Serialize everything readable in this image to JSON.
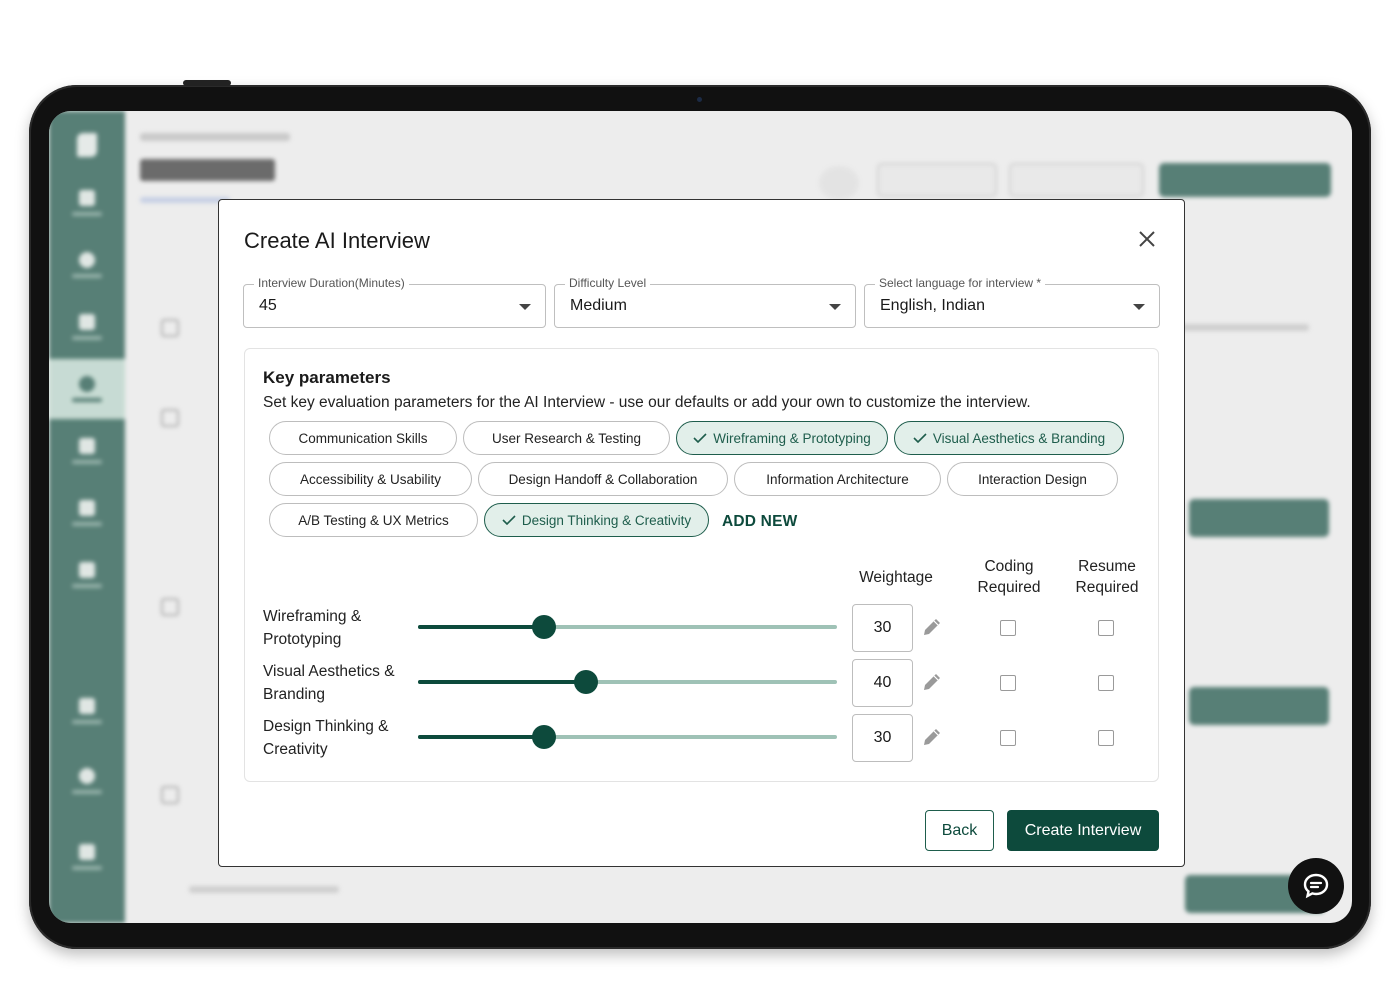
{
  "modal": {
    "title": "Create AI Interview",
    "fields": {
      "duration": {
        "label": "Interview Duration(Minutes)",
        "value": "45"
      },
      "difficulty": {
        "label": "Difficulty Level",
        "value": "Medium"
      },
      "language": {
        "label": "Select language for interview *",
        "value": "English, Indian"
      }
    },
    "params": {
      "title": "Key parameters",
      "description": "Set key evaluation parameters for the AI Interview - use our defaults or add your own to customize the interview.",
      "chips": [
        {
          "label": "Communication Skills",
          "selected": false
        },
        {
          "label": "User Research & Testing",
          "selected": false
        },
        {
          "label": "Wireframing & Prototyping",
          "selected": true
        },
        {
          "label": "Visual Aesthetics & Branding",
          "selected": true
        },
        {
          "label": "Accessibility & Usability",
          "selected": false
        },
        {
          "label": "Design Handoff & Collaboration",
          "selected": false
        },
        {
          "label": "Information Architecture",
          "selected": false
        },
        {
          "label": "Interaction Design",
          "selected": false
        },
        {
          "label": "A/B Testing & UX Metrics",
          "selected": false
        },
        {
          "label": "Design Thinking & Creativity",
          "selected": true
        }
      ],
      "add_new": "ADD NEW",
      "columns": {
        "weightage": "Weightage",
        "coding_l1": "Coding",
        "coding_l2": "Required",
        "resume_l1": "Resume",
        "resume_l2": "Required"
      },
      "rows": [
        {
          "label_l1": "Wireframing &",
          "label_l2": "Prototyping",
          "slider_fraction": 0.3,
          "weightage": "30",
          "coding_required": false,
          "resume_required": false
        },
        {
          "label_l1": "Visual Aesthetics &",
          "label_l2": "Branding",
          "slider_fraction": 0.4,
          "weightage": "40",
          "coding_required": false,
          "resume_required": false
        },
        {
          "label_l1": "Design Thinking &",
          "label_l2": "Creativity",
          "slider_fraction": 0.3,
          "weightage": "30",
          "coding_required": false,
          "resume_required": false
        }
      ]
    },
    "buttons": {
      "back": "Back",
      "create": "Create Interview"
    }
  },
  "icons": {
    "close": "close-icon",
    "caret": "chevron-down-icon",
    "check": "check-icon",
    "edit": "pencil-icon",
    "chat": "chat-icon"
  },
  "colors": {
    "brand": "#0d4a3c",
    "chip_selected_bg": "#e2efea",
    "slider_track": "#9fc2b6"
  }
}
